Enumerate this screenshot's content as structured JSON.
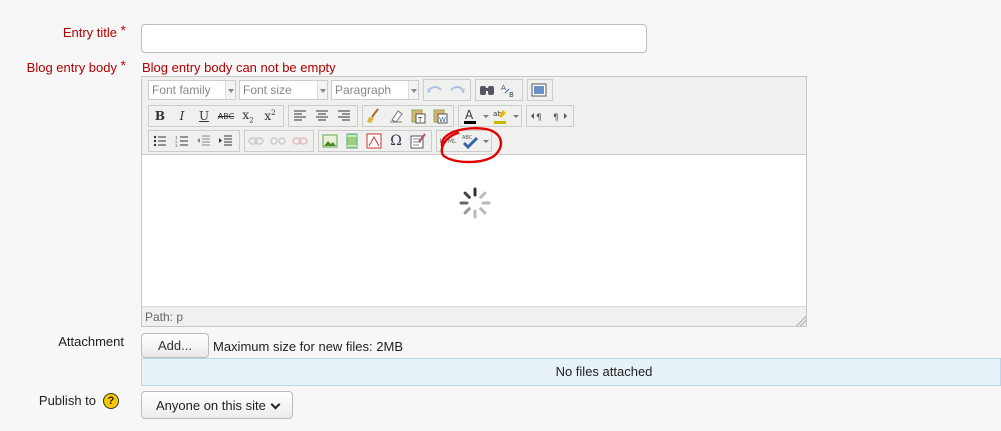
{
  "form": {
    "entry_title_label": "Entry title",
    "required_mark": "*",
    "blog_body_label": "Blog entry body",
    "blog_body_error": "Blog entry body can not be empty",
    "entry_title_value": "",
    "attachment_label": "Attachment",
    "add_button": "Add...",
    "max_size_text": "Maximum size for new files: 2MB",
    "no_files_text": "No files attached",
    "publish_label": "Publish to",
    "help_glyph": "?",
    "publish_selected": "Anyone on this site"
  },
  "editor": {
    "font_family": "Font family",
    "font_size": "Font size",
    "format": "Paragraph",
    "path_text": "Path: p",
    "icons": {
      "row1": [
        "undo-icon",
        "redo-icon",
        "find-icon",
        "replace-icon",
        "fullscreen-icon"
      ],
      "row2": [
        "bold-icon",
        "italic-icon",
        "underline-icon",
        "strikethrough-icon",
        "subscript-icon",
        "superscript-icon",
        "align-left-icon",
        "align-center-icon",
        "align-right-icon",
        "cleanup-icon",
        "remove-format-icon",
        "paste-text-icon",
        "paste-word-icon",
        "text-color-icon",
        "highlight-color-icon",
        "ltr-icon",
        "rtl-icon"
      ],
      "row3": [
        "bullet-list-icon",
        "numbered-list-icon",
        "outdent-icon",
        "indent-icon",
        "link-icon",
        "unlink-icon",
        "anchor-icon",
        "insert-image-icon",
        "insert-media-icon",
        "manage-files-icon",
        "special-char-icon",
        "table-icon",
        "html-source-icon",
        "spellcheck-icon"
      ]
    }
  },
  "colors": {
    "label_red": "#b20000",
    "annotation_circle": "#e00000",
    "files_box_bg": "#e7f1f8"
  }
}
